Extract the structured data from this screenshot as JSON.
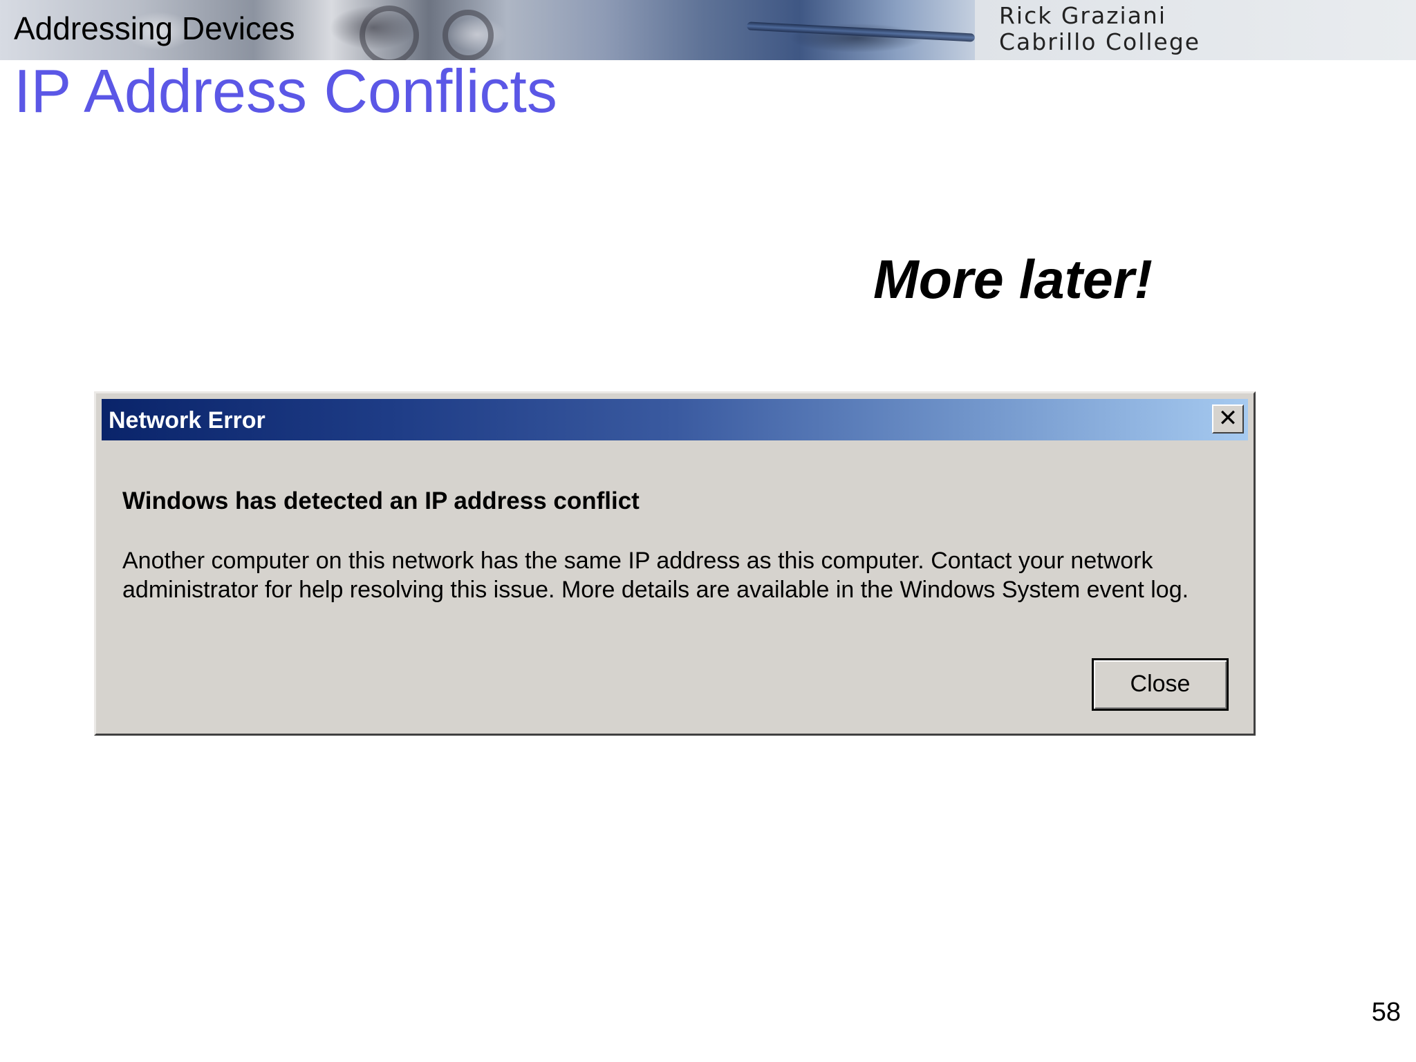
{
  "header": {
    "topic": "Addressing Devices",
    "author_line1": "Rick Graziani",
    "author_line2": "Cabrillo College"
  },
  "slide": {
    "title": "IP Address Conflicts",
    "callout": "More later!",
    "page_number": "58"
  },
  "dialog": {
    "title": "Network Error",
    "close_icon_glyph": "✕",
    "heading": "Windows has detected an IP address conflict",
    "message": "Another computer on this network has the same IP address as this computer. Contact your network administrator for help resolving this issue. More details are available in the Windows System event log.",
    "close_button_label": "Close"
  },
  "colors": {
    "title_color": "#5b57e6",
    "titlebar_start": "#0a246a",
    "titlebar_end": "#a6caf0",
    "dialog_face": "#d6d3ce"
  }
}
